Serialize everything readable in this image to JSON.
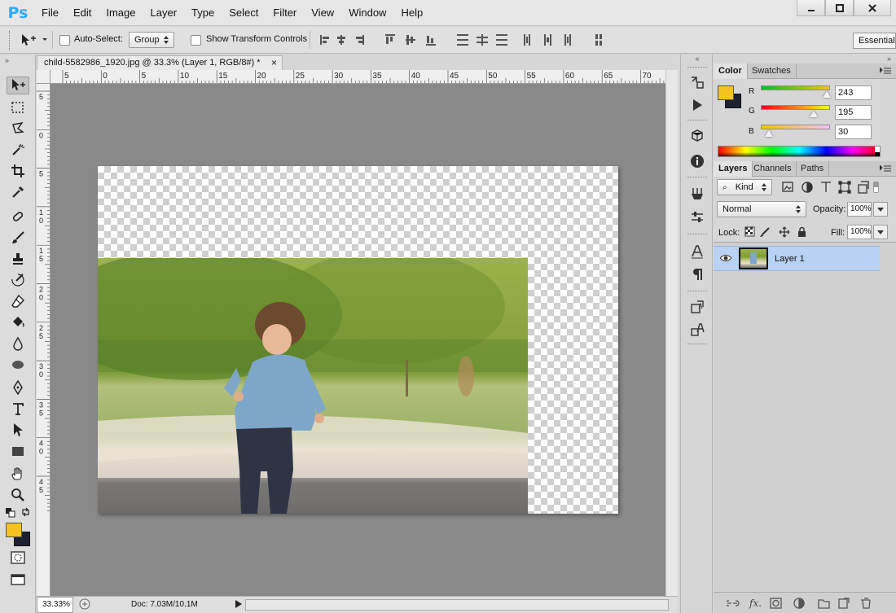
{
  "app": {
    "logo": "Ps",
    "menu": [
      "File",
      "Edit",
      "Image",
      "Layer",
      "Type",
      "Select",
      "Filter",
      "View",
      "Window",
      "Help"
    ],
    "window_controls": [
      "minimize-icon",
      "maximize-icon",
      "close-icon"
    ]
  },
  "options_bar": {
    "auto_select_label": "Auto-Select:",
    "auto_select_value": "Group",
    "show_transform_label": "Show Transform Controls",
    "workspace": "Essential"
  },
  "document": {
    "tab_title": "child-5582986_1920.jpg @ 33.3% (Layer 1, RGB/8#) *",
    "close_glyph": "×",
    "h_ruler_labels": [
      "5",
      "0",
      "5",
      "10",
      "15",
      "20",
      "25",
      "30",
      "35",
      "40",
      "45",
      "50",
      "55",
      "60",
      "65",
      "70"
    ],
    "v_ruler_labels": [
      "5",
      "0",
      "5",
      "1\n0",
      "1\n5",
      "2\n0",
      "2\n5",
      "3\n0",
      "3\n5",
      "4\n0",
      "4\n5"
    ]
  },
  "status": {
    "zoom": "33.33%",
    "doc_size": "Doc: 7.03M/10.1M"
  },
  "colors": {
    "foreground": "#f3c31e",
    "background": "#1e2230",
    "accent": "#b9d1f2"
  },
  "color_panel": {
    "tabs": [
      "Color",
      "Swatches"
    ],
    "channels": [
      {
        "label": "R",
        "value": "243",
        "fraction": 0.953
      },
      {
        "label": "G",
        "value": "195",
        "fraction": 0.765
      },
      {
        "label": "B",
        "value": "30",
        "fraction": 0.118
      }
    ]
  },
  "layers_panel": {
    "tabs": [
      "Layers",
      "Channels",
      "Paths"
    ],
    "filter_kind": "Kind",
    "blend_mode": "Normal",
    "opacity_label": "Opacity:",
    "opacity": "100%",
    "lock_label": "Lock:",
    "fill_label": "Fill:",
    "fill": "100%",
    "layers": [
      {
        "name": "Layer 1",
        "visible": true,
        "selected": true
      }
    ]
  },
  "tools": [
    "move-icon",
    "marquee-icon",
    "lasso-icon",
    "magic-wand-icon",
    "crop-icon",
    "eyedropper-icon",
    "healing-brush-icon",
    "brush-icon",
    "clone-stamp-icon",
    "history-brush-icon",
    "eraser-icon",
    "paint-bucket-icon",
    "blur-icon",
    "dodge-icon",
    "pen-icon",
    "type-icon",
    "path-selection-icon",
    "rectangle-icon",
    "hand-icon",
    "zoom-icon"
  ]
}
